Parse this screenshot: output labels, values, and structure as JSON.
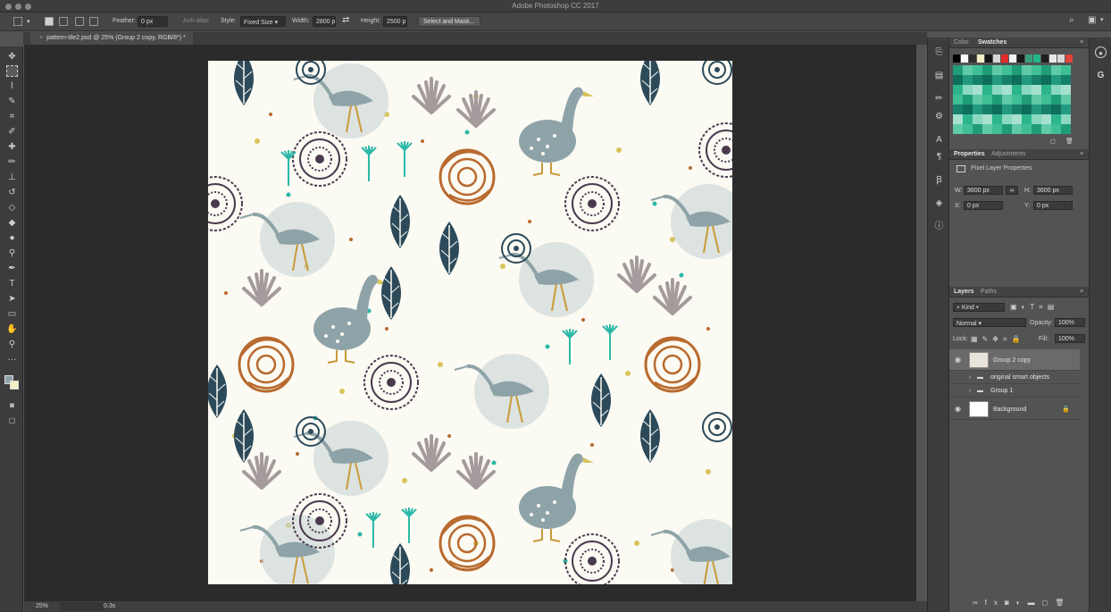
{
  "app": {
    "title": "Adobe Photoshop CC 2017"
  },
  "options": {
    "feather_label": "Feather:",
    "feather_value": "0 px",
    "anti_alias": "Anti-alias",
    "style_label": "Style:",
    "style_value": "Fixed Size",
    "width_label": "Width:",
    "width_value": "2800 p",
    "height_label": "Height:",
    "height_value": "2500 p",
    "select_mask": "Select and Mask..."
  },
  "document": {
    "tab": "pattern-tile2.psd @ 25% (Group 2 copy, RGB/8*) *"
  },
  "status": {
    "zoom": "25%",
    "info": "0.3s"
  },
  "color_panel": {
    "tabs": [
      "Color",
      "Swatches"
    ],
    "swatch_row": [
      "#000000",
      "#ffffff",
      "#2e2e2e",
      "#f2efc7",
      "#151515",
      "#d7d7d7",
      "#e12a2a",
      "#f0f0f0",
      "#1a1a1a",
      "#3a9d7a",
      "#22b48a",
      "#1f1f1f",
      "#e8e8e8",
      "#d9d9d9",
      "#e0443a"
    ]
  },
  "properties": {
    "tabs": [
      "Properties",
      "Adjustments"
    ],
    "title": "Pixel Layer Properties",
    "w_label": "W:",
    "w_value": "3600 px",
    "h_label": "H:",
    "h_value": "3600 px",
    "x_label": "X:",
    "x_value": "0 px",
    "y_label": "Y:",
    "y_value": "0 px"
  },
  "layers_panel": {
    "tabs": [
      "Layers",
      "Paths"
    ],
    "kind": "Kind",
    "blend": "Normal",
    "opacity_label": "Opacity:",
    "opacity_value": "100%",
    "lock_label": "Lock:",
    "fill_label": "Fill:",
    "fill_value": "100%",
    "layers": [
      {
        "name": "Group 2 copy"
      },
      {
        "name": "original smart objects"
      },
      {
        "name": "Group 1"
      },
      {
        "name": "Background"
      }
    ]
  },
  "colors": {
    "teal": "#2bb8a8",
    "navy": "#2c4a5a",
    "rust": "#b86a2e",
    "plum": "#4a3a4e",
    "mustard": "#d8c45a",
    "grey_duck": "#8ea3a8"
  }
}
